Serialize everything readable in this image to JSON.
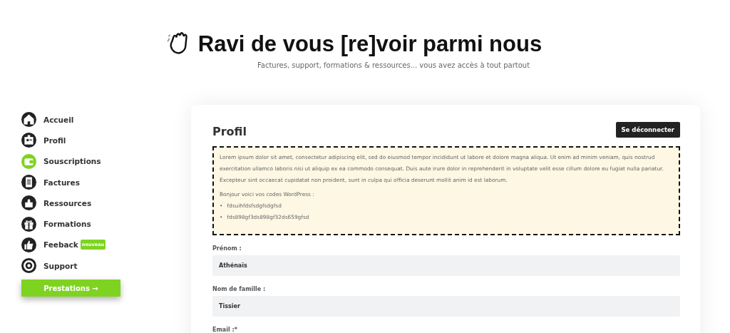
{
  "header": {
    "title": "Ravi de vous [re]voir parmi nous",
    "subtitle": "Factures, support, formations & ressources... vous avez accès à tout partout"
  },
  "sidebar": {
    "items": [
      {
        "label": "Accueil",
        "selected": false
      },
      {
        "label": "Profil",
        "selected": false
      },
      {
        "label": "Souscriptions",
        "selected": true
      },
      {
        "label": "Factures",
        "selected": false
      },
      {
        "label": "Ressources",
        "selected": false
      },
      {
        "label": "Formations",
        "selected": false
      },
      {
        "label": "Feeback",
        "selected": false,
        "badge": "nouveau"
      },
      {
        "label": "Support",
        "selected": false
      }
    ],
    "button": "Prestations →"
  },
  "card": {
    "title": "Profil",
    "logout_button": "Se déconnecter",
    "notice": {
      "paragraph": "Lorem ipsum dolor sit amet, consectetur adipiscing elit, sed do eiusmod tempor incididunt ut labore et dolore magna aliqua. Ut enim ad minim veniam, quis nostrud exercitation ullamco laboris nisi ut aliquip ex ea commodo consequat. Duis aute irure dolor in reprehenderit in voluptate velit esse cillum dolore eu fugiat nulla pariatur. Excepteur sint occaecat cupidatat non proident, sunt in culpa qui officia deserunt mollit anim id est laborum.",
      "intro": "Bonjour voici vos codes WordPress :",
      "codes": [
        {
          "bullet": "•",
          "text": "fdsuihfdsfsdgfsdgfsd"
        },
        {
          "bullet": "•",
          "text": "fds898gf3ds898gf32ds659gfsd"
        }
      ]
    },
    "fields": [
      {
        "label": "Prénom :",
        "value": "Athénaïs"
      },
      {
        "label": "Nom de famille :",
        "value": "Tissier"
      },
      {
        "label": "Email :*"
      }
    ]
  }
}
